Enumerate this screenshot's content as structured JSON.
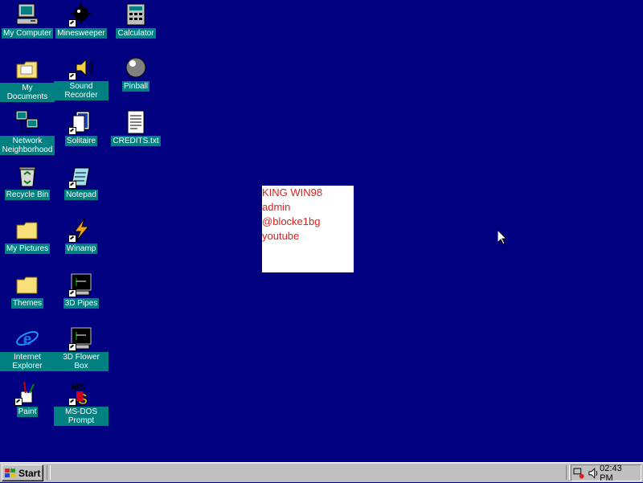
{
  "desktop": {
    "icons": [
      {
        "label": "My Computer"
      },
      {
        "label": "Minesweeper"
      },
      {
        "label": "Calculator"
      },
      {
        "label": "My Documents"
      },
      {
        "label": "Sound Recorder"
      },
      {
        "label": "Pinball"
      },
      {
        "label": "Network Neighborhood"
      },
      {
        "label": "Solitaire"
      },
      {
        "label": "CREDITS.txt"
      },
      {
        "label": "Recycle Bin"
      },
      {
        "label": "Notepad"
      },
      {
        "label": "My Pictures"
      },
      {
        "label": "Winamp"
      },
      {
        "label": "Themes"
      },
      {
        "label": "3D Pipes"
      },
      {
        "label": "Internet Explorer"
      },
      {
        "label": "3D Flower Box"
      },
      {
        "label": "Paint"
      },
      {
        "label": "MS-DOS Prompt"
      }
    ],
    "note": {
      "lines": [
        "KING WIN98",
        "",
        "admin",
        "@blocke1bg",
        "youtube"
      ]
    }
  },
  "taskbar": {
    "start_label": "Start",
    "clock": "02:43 PM"
  },
  "colors": {
    "desktop_bg": "#000080",
    "label_bg": "#008080",
    "note_text": "#e02020",
    "taskbar_bg": "#c0c0c0"
  }
}
